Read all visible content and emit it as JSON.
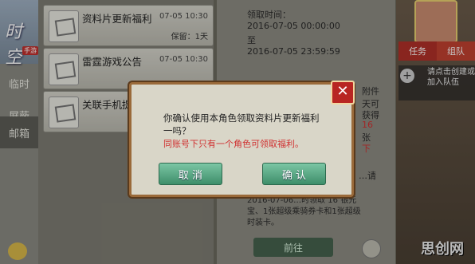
{
  "app": {
    "logo_text": "时空",
    "logo_badge": "手游"
  },
  "nav": {
    "tabs": [
      {
        "label": "临时"
      },
      {
        "label": "屏蔽"
      },
      {
        "label": "邮箱"
      }
    ]
  },
  "mails": [
    {
      "title": "资料片更新福利",
      "date": "07-05 10:30",
      "sub": "保留：1天"
    },
    {
      "title": "雷霆游戏公告",
      "date": "07-05 10:30",
      "sub": ""
    },
    {
      "title": "关联手机提",
      "date": "",
      "sub": ""
    }
  ],
  "detail": {
    "lines": [
      "领取时间：",
      "2016-07-05 00:00:00",
      "至",
      "2016-07-05 23:59:59"
    ],
    "right_fragments": [
      "附件",
      "天可",
      "获得",
      "16",
      "张",
      "下"
    ],
    "bottom_lines": [
      "…请",
      "2016-07-06…时领取 16 银元",
      "宝、1张超级乘骑券卡和1张超级",
      "时装卡。"
    ],
    "bottom_button": "前往"
  },
  "game": {
    "tab_task": "任务",
    "tab_team": "组队",
    "team_hint": "请点击创建或加入队伍",
    "watermark": "思创网"
  },
  "dialog": {
    "message": "你确认使用本角色领取资料片更新福利一吗？",
    "warning": "同账号下只有一个角色可领取福利。",
    "cancel_label": "取 消",
    "confirm_label": "确 认",
    "close_symbol": "✕"
  },
  "colors": {
    "accent_red": "#b82622",
    "button_green": "#3e8e6a",
    "warning_red": "#d03030"
  }
}
